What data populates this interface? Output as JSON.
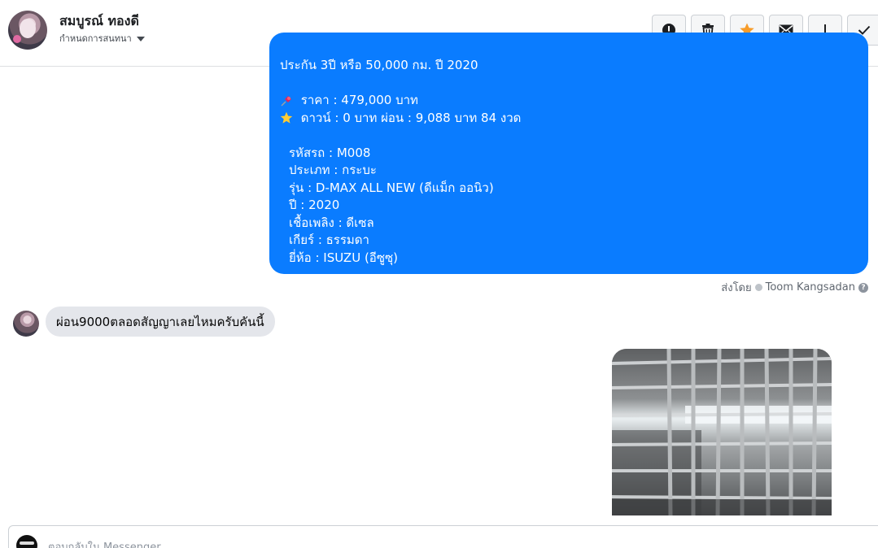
{
  "header": {
    "contact_name": "สมบูรณ์ ทองดี",
    "assign_label": "กำหนดการสนทนา",
    "actions": [
      "alert-icon",
      "trash-icon",
      "star-icon",
      "envelope-icon",
      "exclamation-icon",
      "check-icon"
    ],
    "star_color": "#f79c2a"
  },
  "outgoing": {
    "cutoff_line": "ประกัน 3ปี หรือ 50,000 กม. ปี 2020",
    "price_line": " ราคา : 479,000 บาท",
    "down_line": " ดาวน์ : 0 บาท ผ่อน : 9,088 บาท 84 งวด",
    "details": [
      "รหัสรถ : M008",
      "ประเภท : กระบะ",
      "รุ่น : D-MAX ALL NEW (ดีแม็ก ออนิว)",
      "ปี : 2020",
      "เชื้อเพลิง : ดีเซล",
      "เกียร์ : ธรรมดา",
      "ยี่ห้อ : ISUZU (อีซูซุ)"
    ],
    "bubble_color": "#0a7cff",
    "sent_by_label": "ส่งโดย",
    "sent_by_name": "Toom Kangsadan"
  },
  "incoming": {
    "text": "ผ่อน9000ตลอดสัญญาเลยไหมครับคันนี้"
  },
  "reply": {
    "placeholder": "ตอบกลับใน Messenger..."
  }
}
